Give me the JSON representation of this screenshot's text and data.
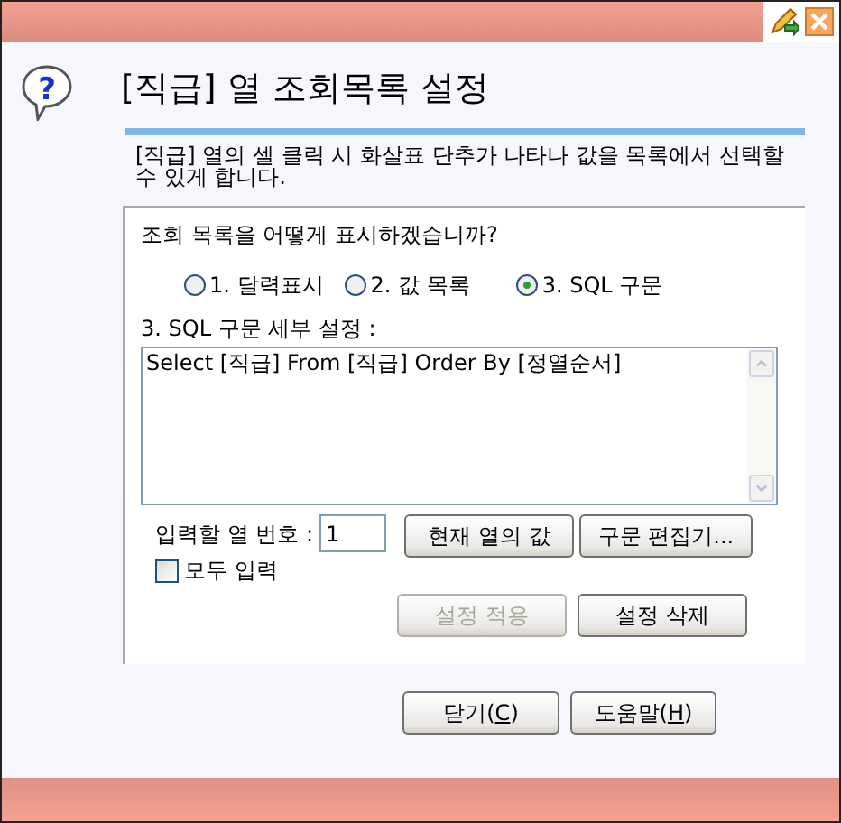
{
  "help_icon": "?",
  "title": "[직급] 열 조회목록 설정",
  "description": "[직급] 열의 셀 클릭 시 화살표 단추가 나타나 값을 목록에서 선택할 수 있게 합니다.",
  "question": "조회 목록을 어떻게 표시하겠습니까?",
  "options": [
    {
      "label": "1. 달력표시",
      "selected": false
    },
    {
      "label": "2. 값 목록",
      "selected": false
    },
    {
      "label": "3. SQL 구문",
      "selected": true
    }
  ],
  "sql_label": "3. SQL 구문 세부 설정 :",
  "sql_value": "Select [직급] From [직급] Order By [정열순서]",
  "column_label": "입력할 열 번호 :",
  "column_value": "1",
  "row_buttons": [
    {
      "label": "현재 열의 값",
      "disabled": false
    },
    {
      "label": "구문 편집기...",
      "disabled": false
    }
  ],
  "all_input": {
    "label": "모두 입력",
    "checked": false
  },
  "setting_buttons": [
    {
      "label": "설정 적용",
      "disabled": true
    },
    {
      "label": "설정 삭제",
      "disabled": false
    }
  ],
  "footer_buttons": [
    {
      "label_parts": [
        "닫기(",
        "C",
        ")"
      ]
    },
    {
      "label_parts": [
        "도움말(",
        "H",
        ")"
      ]
    }
  ]
}
